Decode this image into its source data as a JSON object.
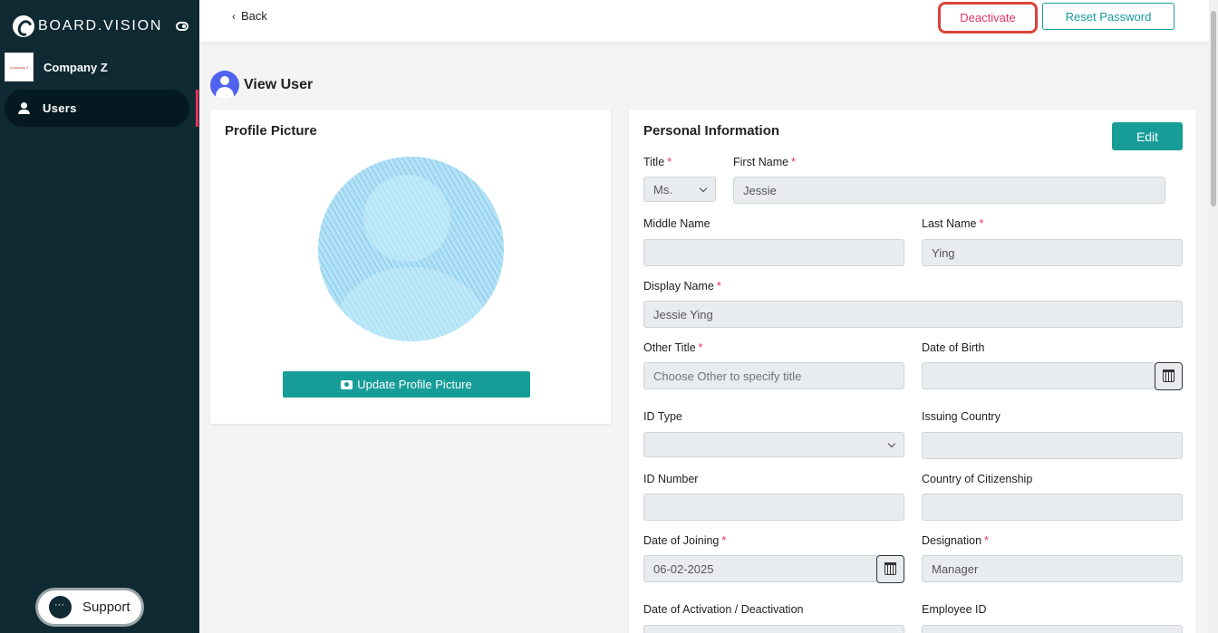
{
  "sidebar": {
    "brand": "BOARD.VISION",
    "company_logo_text": "Company Z",
    "company_name": "Company Z",
    "nav_users": "Users",
    "support": "Support"
  },
  "topbar": {
    "back": "Back",
    "deactivate": "Deactivate",
    "reset_password": "Reset Password"
  },
  "page": {
    "title": "View User"
  },
  "profile": {
    "title": "Profile Picture",
    "update_button": "Update Profile Picture"
  },
  "personal": {
    "title": "Personal Information",
    "edit": "Edit",
    "fields": {
      "title": {
        "label": "Title",
        "required": "*",
        "value": "Ms."
      },
      "first_name": {
        "label": "First Name",
        "required": "*",
        "value": "Jessie"
      },
      "middle_name": {
        "label": "Middle Name",
        "value": ""
      },
      "last_name": {
        "label": "Last Name",
        "required": "*",
        "value": "Ying"
      },
      "display_name": {
        "label": "Display Name",
        "required": "*",
        "value": "Jessie Ying"
      },
      "other_title": {
        "label": "Other Title",
        "required": "*",
        "placeholder": "Choose Other to specify title"
      },
      "dob": {
        "label": "Date of Birth",
        "value": ""
      },
      "id_type": {
        "label": "ID Type",
        "value": ""
      },
      "issuing_country": {
        "label": "Issuing Country",
        "value": ""
      },
      "id_number": {
        "label": "ID Number",
        "value": ""
      },
      "citizenship": {
        "label": "Country of Citizenship",
        "value": ""
      },
      "joining": {
        "label": "Date of Joining",
        "required": "*",
        "value": "06-02-2025"
      },
      "designation": {
        "label": "Designation",
        "required": "*",
        "value": "Manager"
      },
      "activation": {
        "label": "Date of Activation / Deactivation",
        "value": ""
      },
      "employee_id": {
        "label": "Employee ID",
        "value": ""
      }
    }
  },
  "colors": {
    "sidebar": "#0f2a33",
    "accent": "#179d98",
    "danger": "#e8325c",
    "heading_icon": "#4f63ee"
  },
  "icons": [
    "toggle-icon",
    "user-icon",
    "chat-icon",
    "chevron-left-icon",
    "user-circle-icon",
    "camera-icon",
    "calendar-icon",
    "chevron-down-icon"
  ]
}
